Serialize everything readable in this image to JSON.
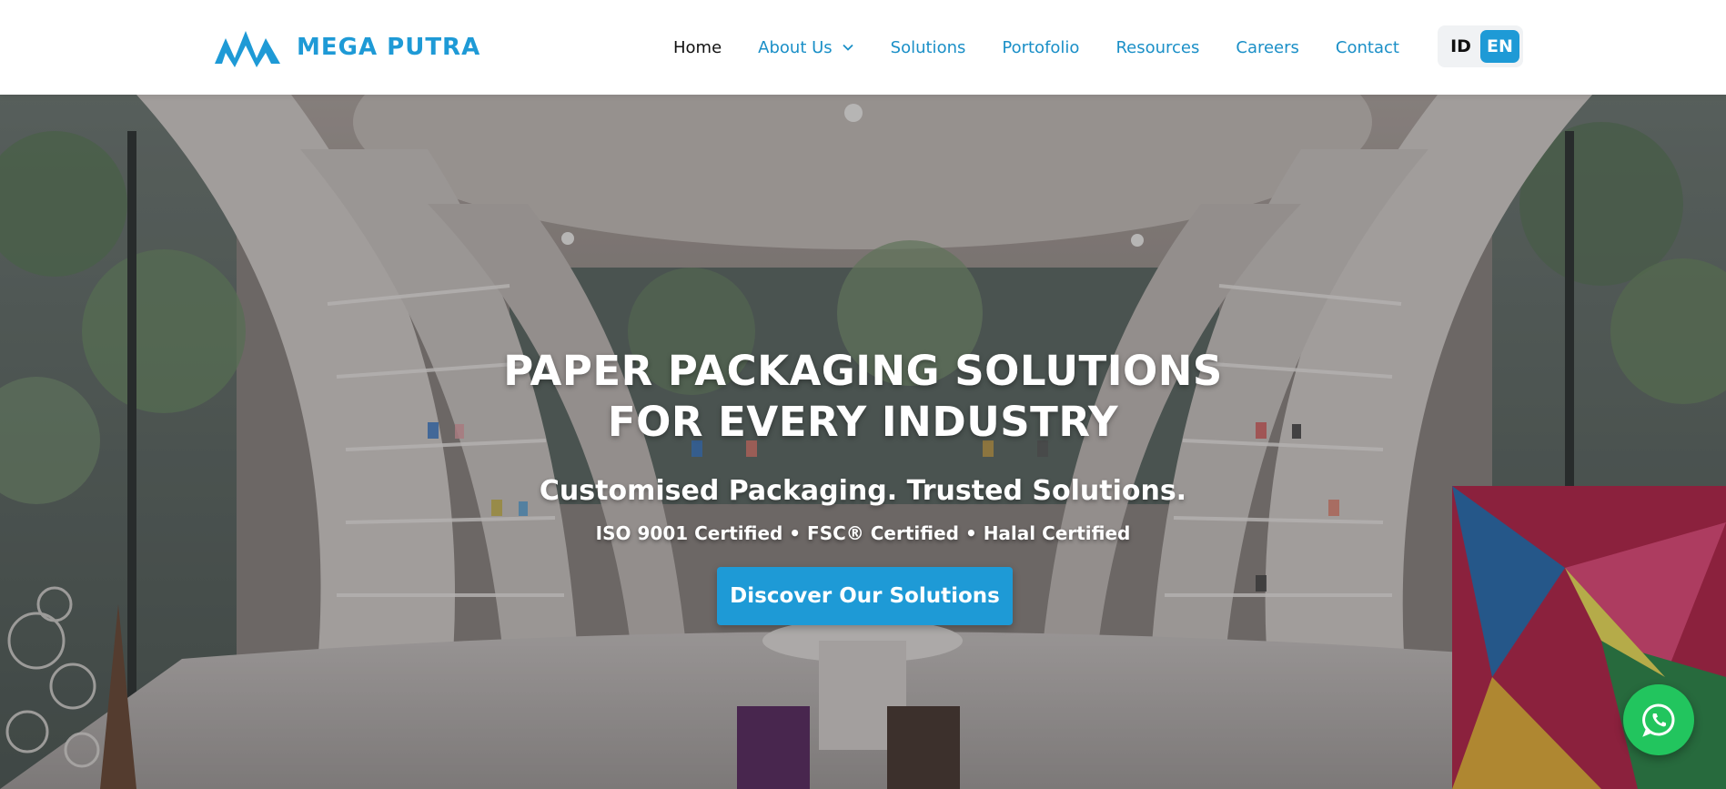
{
  "brand": {
    "name": "MEGA PUTRA",
    "color": "#1e9ad6",
    "logo_icon": "mega-putra-logo-icon"
  },
  "nav": {
    "items": [
      {
        "label": "Home",
        "active": true
      },
      {
        "label": "About Us",
        "has_dropdown": true,
        "icon": "chevron-down-icon"
      },
      {
        "label": "Solutions"
      },
      {
        "label": "Portofolio"
      },
      {
        "label": "Resources"
      },
      {
        "label": "Careers"
      },
      {
        "label": "Contact"
      }
    ]
  },
  "language": {
    "options": [
      "ID",
      "EN"
    ],
    "selected": "EN"
  },
  "hero": {
    "title_line1": "PAPER PACKAGING SOLUTIONS",
    "title_line2": "FOR EVERY INDUSTRY",
    "subtitle": "Customised Packaging. Trusted Solutions.",
    "certifications": "ISO 9001 Certified • FSC® Certified • Halal Certified",
    "cta_label": "Discover Our Solutions"
  },
  "floating": {
    "whatsapp_icon": "whatsapp-icon",
    "color": "#22c55e"
  }
}
